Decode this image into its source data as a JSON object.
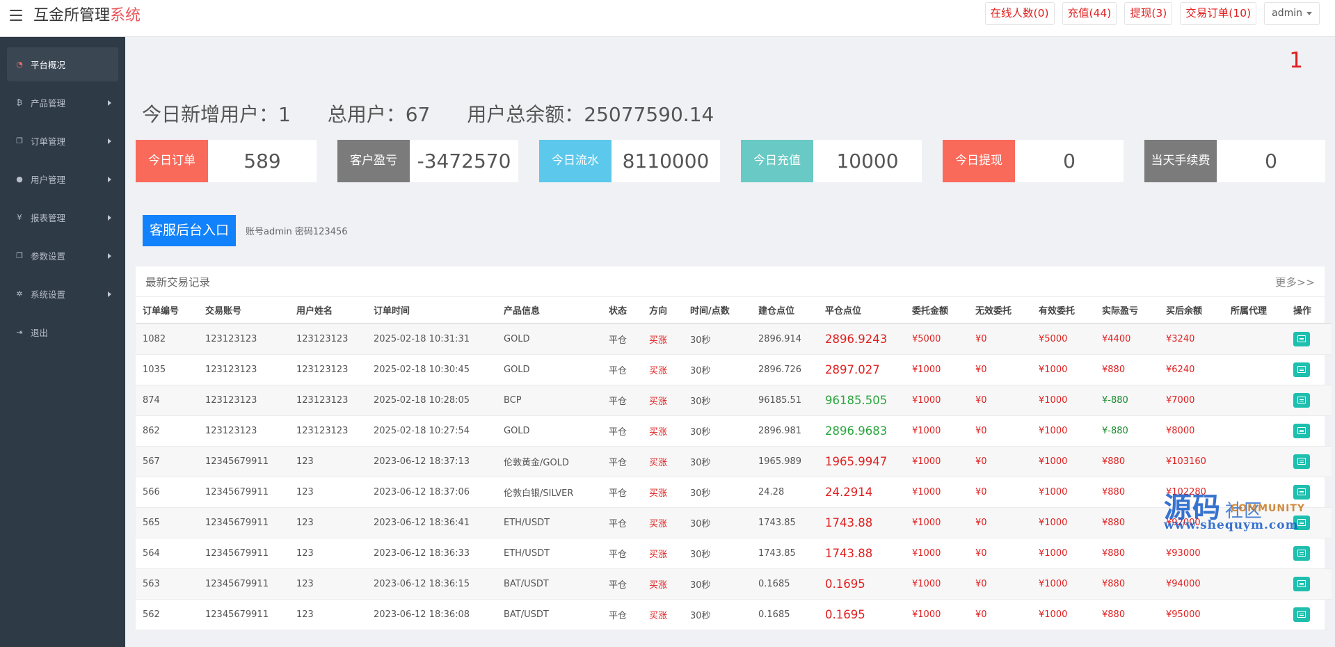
{
  "app": {
    "title_prefix": "互金所管理",
    "title_accent": "系统"
  },
  "topbar": {
    "online": "在线人数(0)",
    "recharge": "充值(44)",
    "withdraw": "提现(3)",
    "orders": "交易订单(10)",
    "user": "admin"
  },
  "sidebar": {
    "items": [
      {
        "label": "平台概况",
        "icon": "dashboard-icon"
      },
      {
        "label": "产品管理",
        "icon": "bitcoin-icon"
      },
      {
        "label": "订单管理",
        "icon": "copy-icon"
      },
      {
        "label": "用户管理",
        "icon": "user-icon"
      },
      {
        "label": "报表管理",
        "icon": "yen-icon"
      },
      {
        "label": "参数设置",
        "icon": "copy-icon"
      },
      {
        "label": "系统设置",
        "icon": "gears-icon"
      },
      {
        "label": "退出",
        "icon": "logout-icon"
      }
    ]
  },
  "main": {
    "page_num": "1",
    "summary": {
      "new_users": "今日新增用户：1",
      "total_users": "总用户：67",
      "total_balance": "用户总余额：25077590.14"
    },
    "cards": [
      {
        "label": "今日订单",
        "value": "589",
        "color": "#fa6a5b"
      },
      {
        "label": "客户盈亏",
        "value": "-3472570",
        "color": "#7b7b7b"
      },
      {
        "label": "今日流水",
        "value": "8110000",
        "color": "#5bc8ec"
      },
      {
        "label": "今日充值",
        "value": "10000",
        "color": "#69c9c4"
      },
      {
        "label": "今日提现",
        "value": "0",
        "color": "#fa6a5b"
      },
      {
        "label": "当天手续费",
        "value": "0",
        "color": "#7b7b7b"
      }
    ],
    "kf_button": "客服后台入口",
    "kf_note": "账号admin 密码123456"
  },
  "trades": {
    "title": "最新交易记录",
    "more": "更多>>",
    "headers": [
      "订单编号",
      "交易账号",
      "用户姓名",
      "订单时间",
      "产品信息",
      "状态",
      "方向",
      "时间/点数",
      "建仓点位",
      "平仓点位",
      "委托金额",
      "无效委托",
      "有效委托",
      "实际盈亏",
      "买后余额",
      "所属代理",
      "操作"
    ],
    "rows": [
      {
        "id": "1082",
        "account": "123123123",
        "name": "123123123",
        "time": "2025-02-18 10:31:31",
        "product": "GOLD",
        "status": "平仓",
        "dir": "买涨",
        "period": "30秒",
        "open": "2896.914",
        "close": "2896.9243",
        "close_color": "red",
        "amount": "¥5000",
        "invalid": "¥0",
        "valid": "¥5000",
        "profit": "¥4400",
        "profit_color": "red",
        "balance": "¥3240",
        "agent": ""
      },
      {
        "id": "1035",
        "account": "123123123",
        "name": "123123123",
        "time": "2025-02-18 10:30:45",
        "product": "GOLD",
        "status": "平仓",
        "dir": "买涨",
        "period": "30秒",
        "open": "2896.726",
        "close": "2897.027",
        "close_color": "red",
        "amount": "¥1000",
        "invalid": "¥0",
        "valid": "¥1000",
        "profit": "¥880",
        "profit_color": "red",
        "balance": "¥6240",
        "agent": ""
      },
      {
        "id": "874",
        "account": "123123123",
        "name": "123123123",
        "time": "2025-02-18 10:28:05",
        "product": "BCP",
        "status": "平仓",
        "dir": "买涨",
        "period": "30秒",
        "open": "96185.51",
        "close": "96185.505",
        "close_color": "green",
        "amount": "¥1000",
        "invalid": "¥0",
        "valid": "¥1000",
        "profit": "¥-880",
        "profit_color": "green",
        "balance": "¥7000",
        "agent": ""
      },
      {
        "id": "862",
        "account": "123123123",
        "name": "123123123",
        "time": "2025-02-18 10:27:54",
        "product": "GOLD",
        "status": "平仓",
        "dir": "买涨",
        "period": "30秒",
        "open": "2896.981",
        "close": "2896.9683",
        "close_color": "green",
        "amount": "¥1000",
        "invalid": "¥0",
        "valid": "¥1000",
        "profit": "¥-880",
        "profit_color": "green",
        "balance": "¥8000",
        "agent": ""
      },
      {
        "id": "567",
        "account": "12345679911",
        "name": "123",
        "time": "2023-06-12 18:37:13",
        "product": "伦敦黄金/GOLD",
        "status": "平仓",
        "dir": "买涨",
        "period": "30秒",
        "open": "1965.989",
        "close": "1965.9947",
        "close_color": "red",
        "amount": "¥1000",
        "invalid": "¥0",
        "valid": "¥1000",
        "profit": "¥880",
        "profit_color": "red",
        "balance": "¥103160",
        "agent": ""
      },
      {
        "id": "566",
        "account": "12345679911",
        "name": "123",
        "time": "2023-06-12 18:37:06",
        "product": "伦敦白银/SILVER",
        "status": "平仓",
        "dir": "买涨",
        "period": "30秒",
        "open": "24.28",
        "close": "24.2914",
        "close_color": "red",
        "amount": "¥1000",
        "invalid": "¥0",
        "valid": "¥1000",
        "profit": "¥880",
        "profit_color": "red",
        "balance": "¥102280",
        "agent": ""
      },
      {
        "id": "565",
        "account": "12345679911",
        "name": "123",
        "time": "2023-06-12 18:36:41",
        "product": "ETH/USDT",
        "status": "平仓",
        "dir": "买涨",
        "period": "30秒",
        "open": "1743.85",
        "close": "1743.88",
        "close_color": "red",
        "amount": "¥1000",
        "invalid": "¥0",
        "valid": "¥1000",
        "profit": "¥880",
        "profit_color": "red",
        "balance": "¥92000",
        "agent": ""
      },
      {
        "id": "564",
        "account": "12345679911",
        "name": "123",
        "time": "2023-06-12 18:36:33",
        "product": "ETH/USDT",
        "status": "平仓",
        "dir": "买涨",
        "period": "30秒",
        "open": "1743.85",
        "close": "1743.88",
        "close_color": "red",
        "amount": "¥1000",
        "invalid": "¥0",
        "valid": "¥1000",
        "profit": "¥880",
        "profit_color": "red",
        "balance": "¥93000",
        "agent": ""
      },
      {
        "id": "563",
        "account": "12345679911",
        "name": "123",
        "time": "2023-06-12 18:36:15",
        "product": "BAT/USDT",
        "status": "平仓",
        "dir": "买涨",
        "period": "30秒",
        "open": "0.1685",
        "close": "0.1695",
        "close_color": "red",
        "amount": "¥1000",
        "invalid": "¥0",
        "valid": "¥1000",
        "profit": "¥880",
        "profit_color": "red",
        "balance": "¥94000",
        "agent": ""
      },
      {
        "id": "562",
        "account": "12345679911",
        "name": "123",
        "time": "2023-06-12 18:36:08",
        "product": "BAT/USDT",
        "status": "平仓",
        "dir": "买涨",
        "period": "30秒",
        "open": "0.1685",
        "close": "0.1695",
        "close_color": "red",
        "amount": "¥1000",
        "invalid": "¥0",
        "valid": "¥1000",
        "profit": "¥880",
        "profit_color": "red",
        "balance": "¥95000",
        "agent": ""
      }
    ]
  },
  "watermark": {
    "cn": "源码",
    "cn2": "社区",
    "en": "COMMUNITY",
    "url": "www.shequym.com"
  }
}
